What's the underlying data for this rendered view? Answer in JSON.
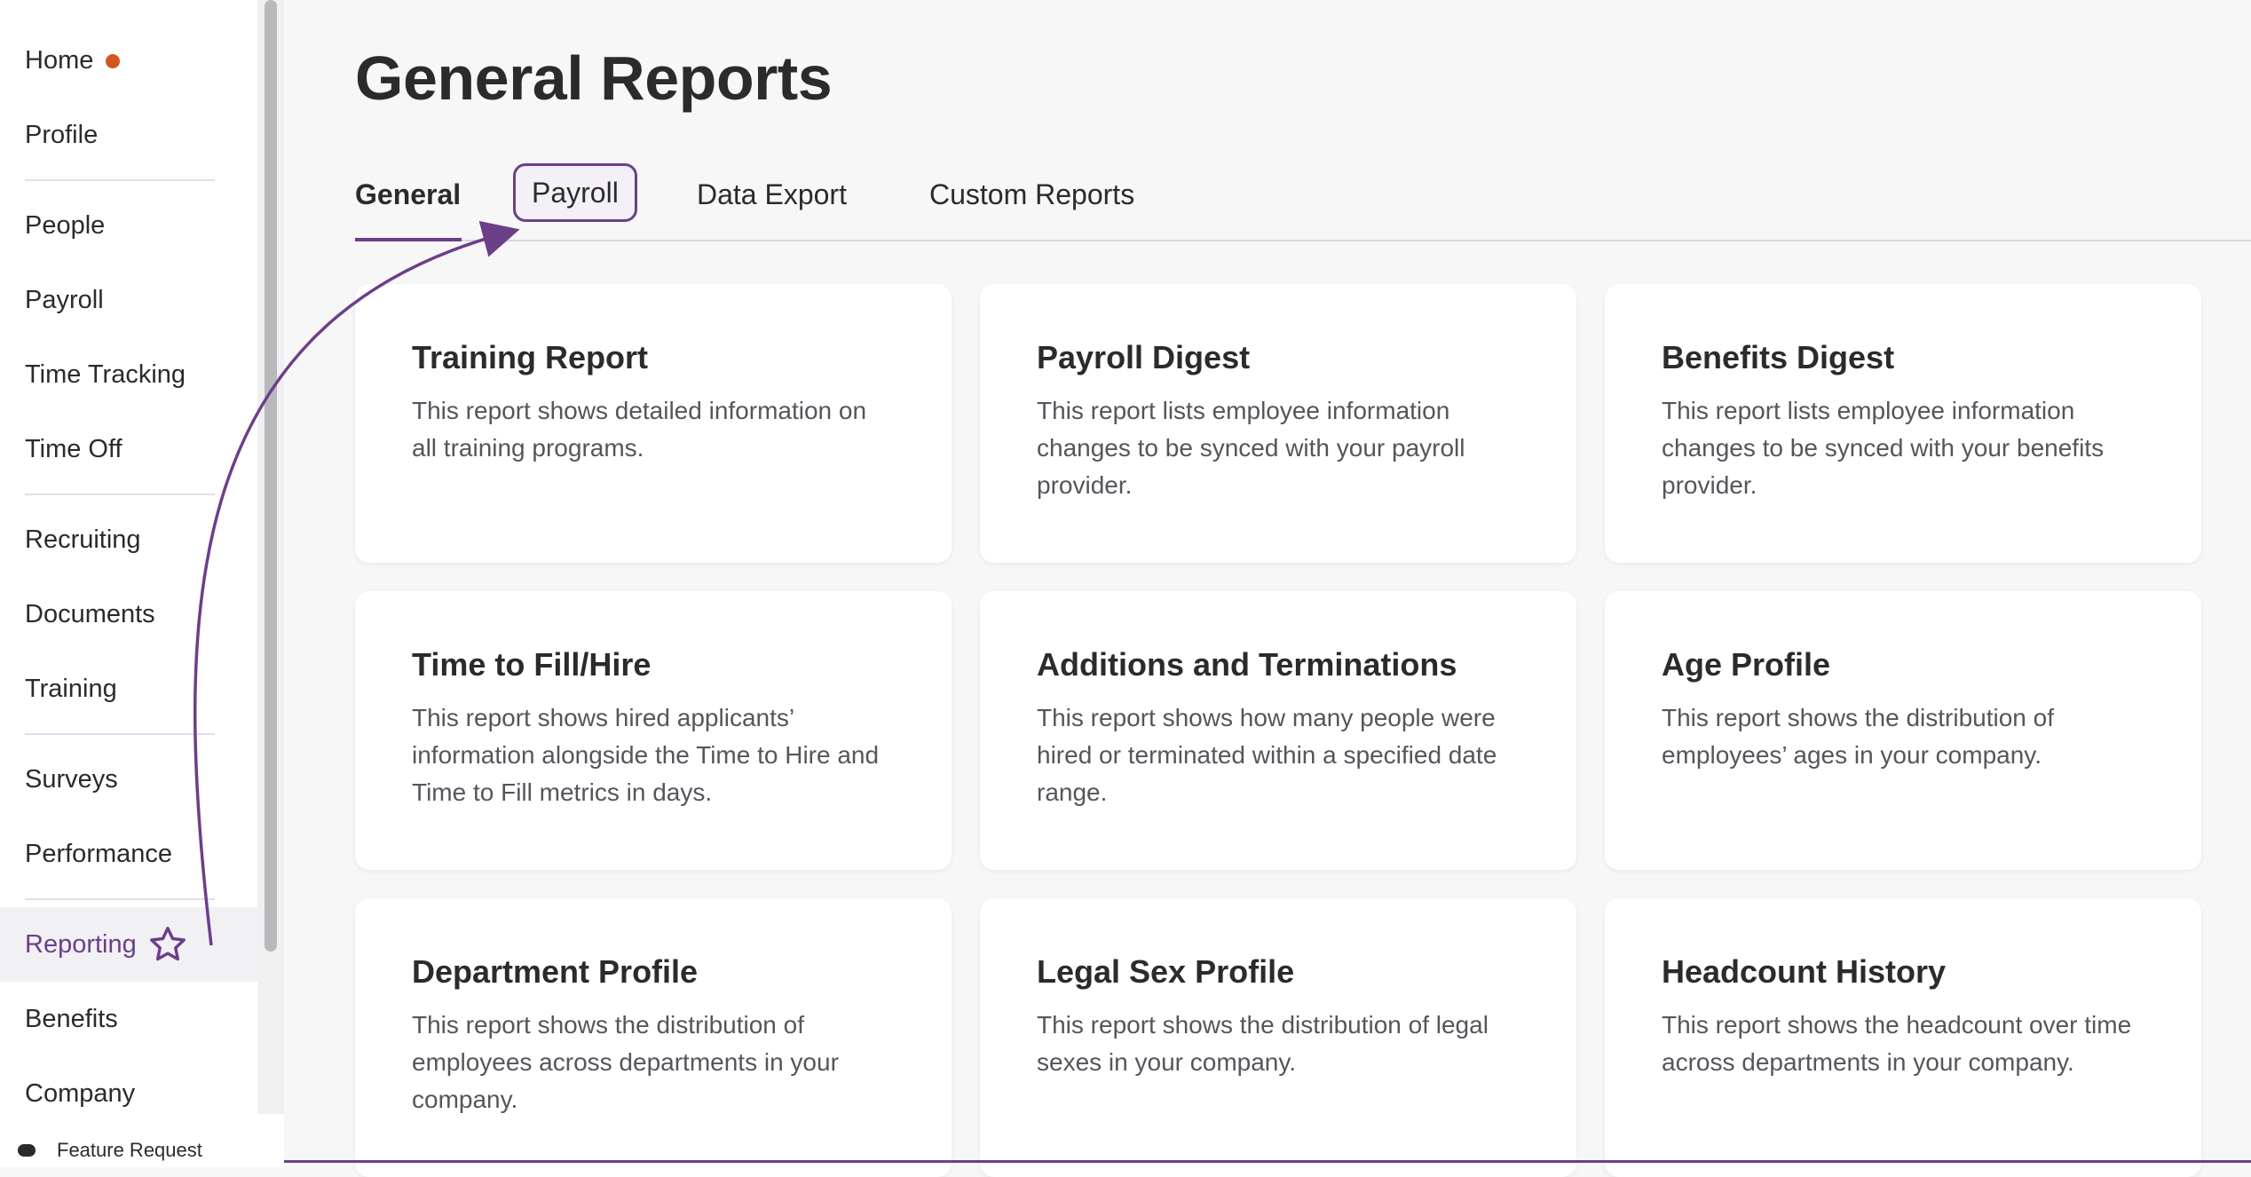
{
  "sidebar": {
    "items": [
      {
        "label": "Home"
      },
      {
        "label": "Profile"
      },
      {
        "label": "People"
      },
      {
        "label": "Payroll"
      },
      {
        "label": "Time Tracking"
      },
      {
        "label": "Time Off"
      },
      {
        "label": "Recruiting"
      },
      {
        "label": "Documents"
      },
      {
        "label": "Training"
      },
      {
        "label": "Surveys"
      },
      {
        "label": "Performance"
      },
      {
        "label": "Reporting"
      },
      {
        "label": "Benefits"
      },
      {
        "label": "Company"
      }
    ],
    "active_item": "Reporting",
    "footer_link": "Feature Request"
  },
  "header": {
    "title": "General Reports"
  },
  "tabs": [
    {
      "label": "General"
    },
    {
      "label": "Payroll"
    },
    {
      "label": "Data Export"
    },
    {
      "label": "Custom Reports"
    }
  ],
  "active_tab": "General",
  "highlighted_tab": "Payroll",
  "cards": [
    {
      "title": "Training Report",
      "description": "This report shows detailed information on all training programs."
    },
    {
      "title": "Payroll Digest",
      "description": "This report lists employee information changes to be synced with your payroll provider."
    },
    {
      "title": "Benefits Digest",
      "description": "This report lists employee information changes to be synced with your benefits provider."
    },
    {
      "title": "Time to Fill/Hire",
      "description": "This report shows hired applicants’ information alongside the Time to Hire and Time to Fill metrics in days."
    },
    {
      "title": "Additions and Terminations",
      "description": "This report shows how many people were hired or terminated within a specified date range."
    },
    {
      "title": "Age Profile",
      "description": "This report shows the distribution of employees’ ages in your company."
    },
    {
      "title": "Department Profile",
      "description": "This report shows the distribution of employees across departments in your company."
    },
    {
      "title": "Legal Sex Profile",
      "description": "This report shows the distribution of legal sexes in your company."
    },
    {
      "title": "Headcount History",
      "description": "This report shows the headcount over time across departments in your company."
    }
  ],
  "colors": {
    "accent": "#6b3f8a",
    "notification_dot": "#d4561c",
    "background": "#f7f7f8"
  },
  "icons": {
    "home_badge": "notification-dot-icon",
    "reporting_badge": "star-icon",
    "footer": "chat-bubble-icon"
  }
}
